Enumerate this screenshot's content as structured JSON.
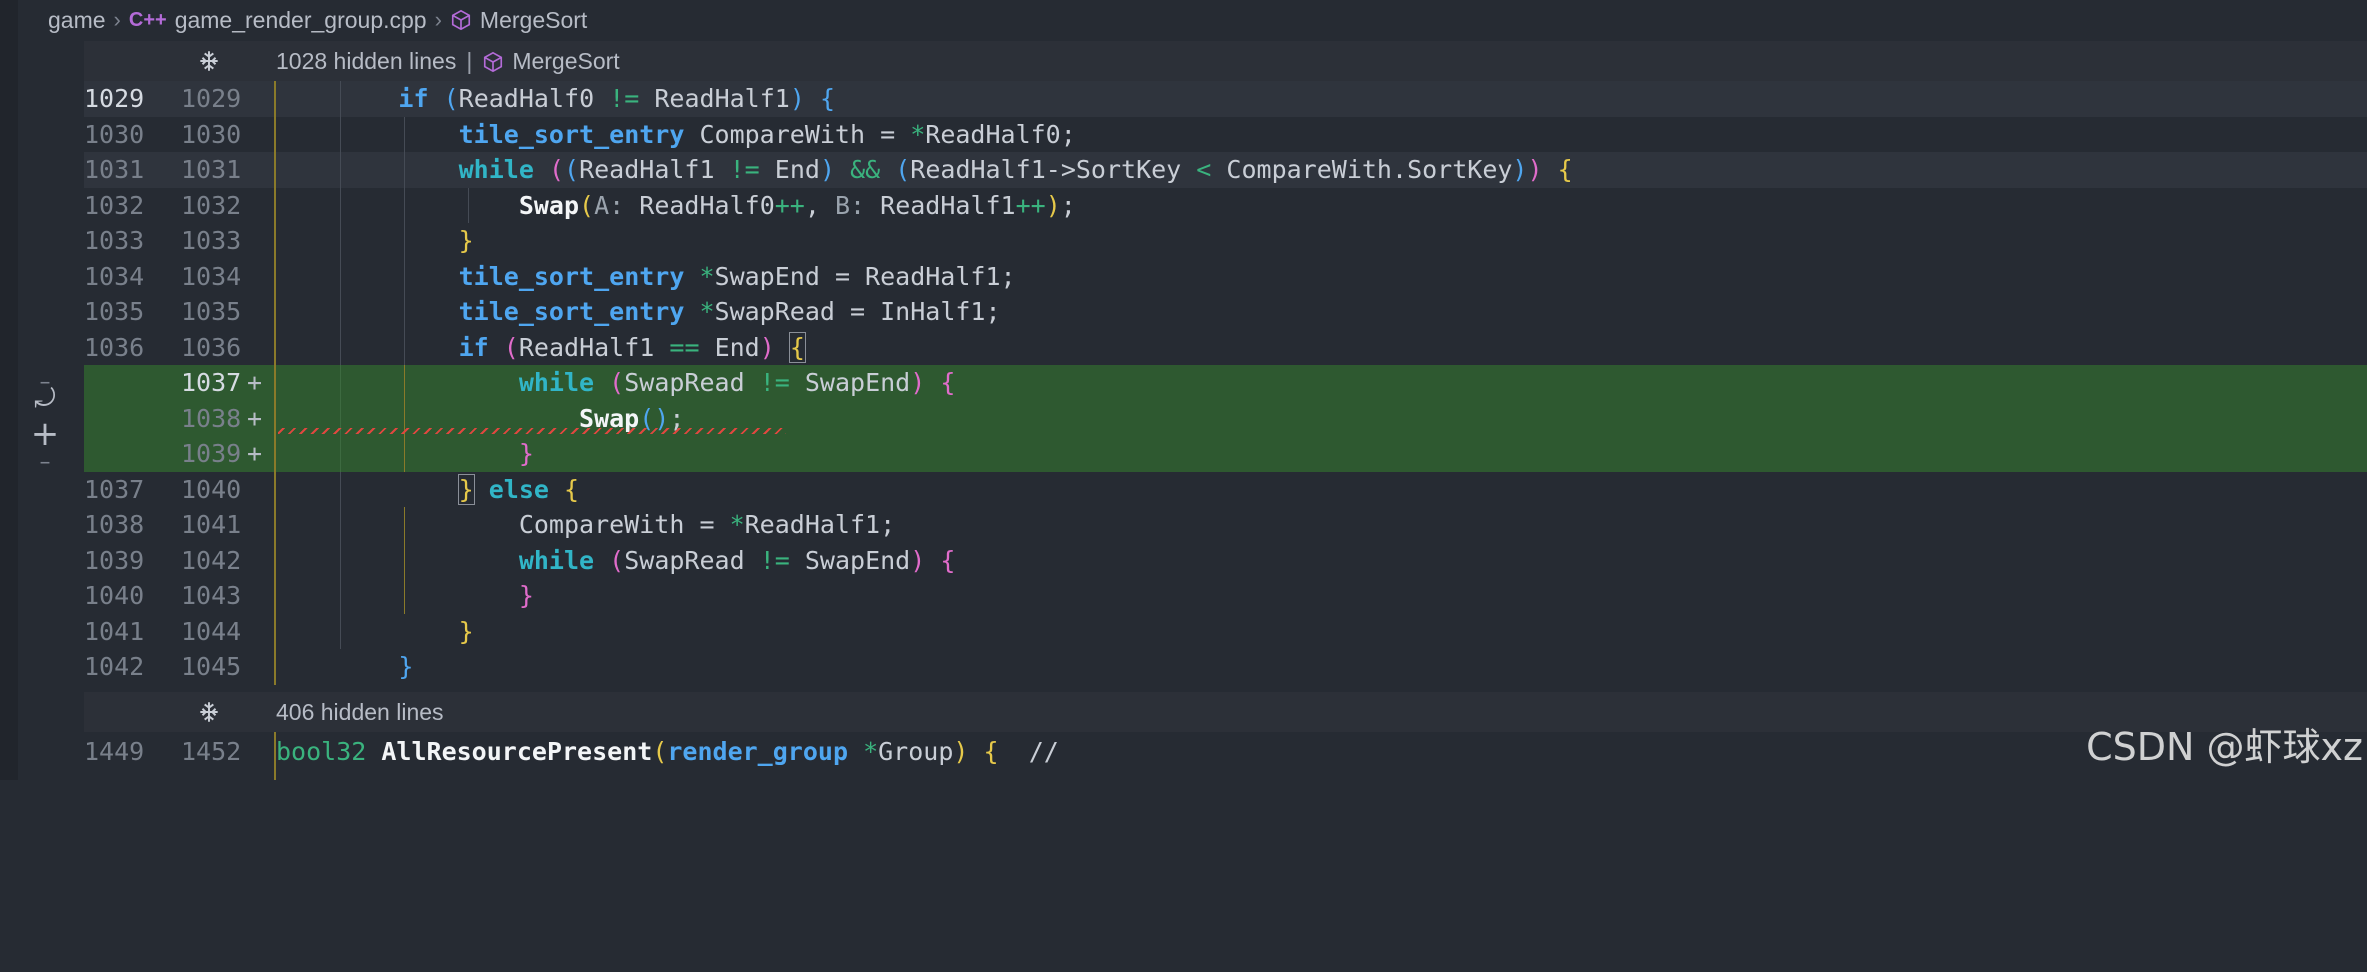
{
  "breadcrumb": {
    "folder": "game",
    "file_icon": "C++",
    "file": "game_render_group.cpp",
    "symbol": "MergeSort"
  },
  "fold_top": {
    "text": "1028 hidden lines",
    "symbol": "MergeSort"
  },
  "fold_bottom": {
    "text": "406 hidden lines"
  },
  "code_lines": [
    {
      "l": "1029",
      "r": "1029"
    },
    {
      "l": "1030",
      "r": "1030"
    },
    {
      "l": "1031",
      "r": "1031"
    },
    {
      "l": "1032",
      "r": "1032"
    },
    {
      "l": "1033",
      "r": "1033"
    },
    {
      "l": "1034",
      "r": "1034"
    },
    {
      "l": "1035",
      "r": "1035"
    },
    {
      "l": "1036",
      "r": "1036"
    },
    {
      "l": "",
      "r": "1037",
      "plus": "+"
    },
    {
      "l": "",
      "r": "1038",
      "plus": "+"
    },
    {
      "l": "",
      "r": "1039",
      "plus": "+"
    },
    {
      "l": "1037",
      "r": "1040"
    },
    {
      "l": "1038",
      "r": "1041"
    },
    {
      "l": "1039",
      "r": "1042"
    },
    {
      "l": "1040",
      "r": "1043"
    },
    {
      "l": "1041",
      "r": "1044"
    },
    {
      "l": "1042",
      "r": "1045"
    }
  ],
  "last_line": {
    "l": "1449",
    "r": "1452"
  },
  "tokens": {
    "if": "if",
    "while": "while",
    "else": "else",
    "tile_sort_entry": "tile_sort_entry",
    "Swap": "Swap",
    "ReadHalf0": "ReadHalf0",
    "ReadHalf1": "ReadHalf1",
    "CompareWith": "CompareWith",
    "End": "End",
    "SortKey": "SortKey",
    "SwapEnd": "SwapEnd",
    "SwapRead": "SwapRead",
    "InHalf1": "InHalf1",
    "hintA": "A:",
    "hintB": "B:",
    "bool32": "bool32",
    "AllResourcePresent": "AllResourcePresent",
    "render_group": "render_group",
    "Group": "Group",
    "comment": "//"
  },
  "diff_controls": {
    "revert": "⤾",
    "add": "+"
  },
  "watermark": "CSDN @虾球xz",
  "colors": {
    "added_bg": "#2e5930",
    "keyword": "#4fa6f0",
    "operator": "#3ab37e"
  }
}
